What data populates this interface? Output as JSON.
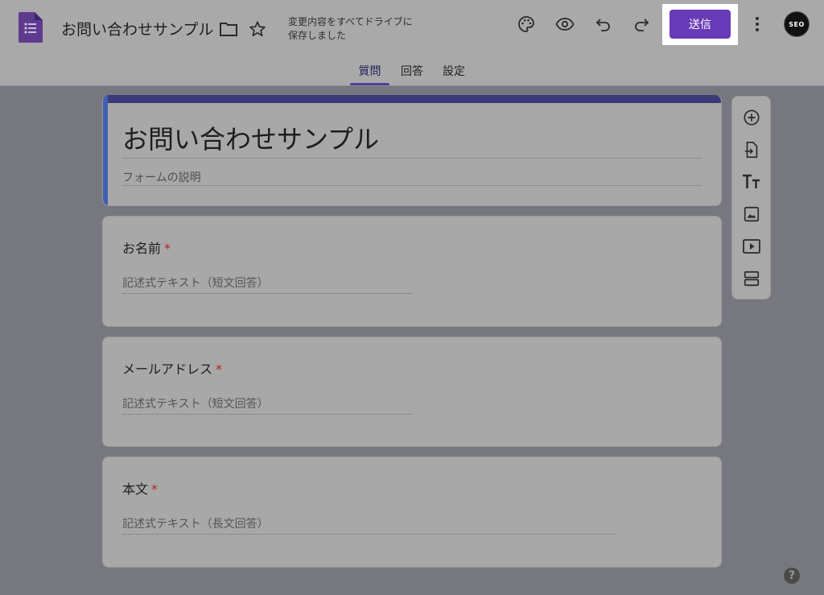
{
  "header": {
    "doc_title": "お問い合わせサンプル",
    "save_status_line1": "変更内容をすべてドライブに",
    "save_status_line2": "保存しました",
    "send_label": "送信",
    "avatar_text": "SEO"
  },
  "tabs": [
    {
      "label": "質問",
      "active": true
    },
    {
      "label": "回答",
      "active": false
    },
    {
      "label": "設定",
      "active": false
    }
  ],
  "form": {
    "title": "お問い合わせサンプル",
    "description_placeholder": "フォームの説明",
    "questions": [
      {
        "title": "お名前",
        "required_mark": "*",
        "hint": "記述式テキスト（短文回答）"
      },
      {
        "title": "メールアドレス",
        "required_mark": "*",
        "hint": "記述式テキスト（短文回答）"
      },
      {
        "title": "本文",
        "required_mark": "*",
        "hint": "記述式テキスト（長文回答）"
      }
    ]
  },
  "toolbar": {
    "items": [
      "add-question-icon",
      "import-questions-icon",
      "add-title-icon",
      "add-image-icon",
      "add-video-icon",
      "add-section-icon"
    ]
  },
  "help": {
    "label": "?"
  },
  "colors": {
    "accent": "#673ab7",
    "overlay_background": "#76777f",
    "required": "#b3261e"
  }
}
